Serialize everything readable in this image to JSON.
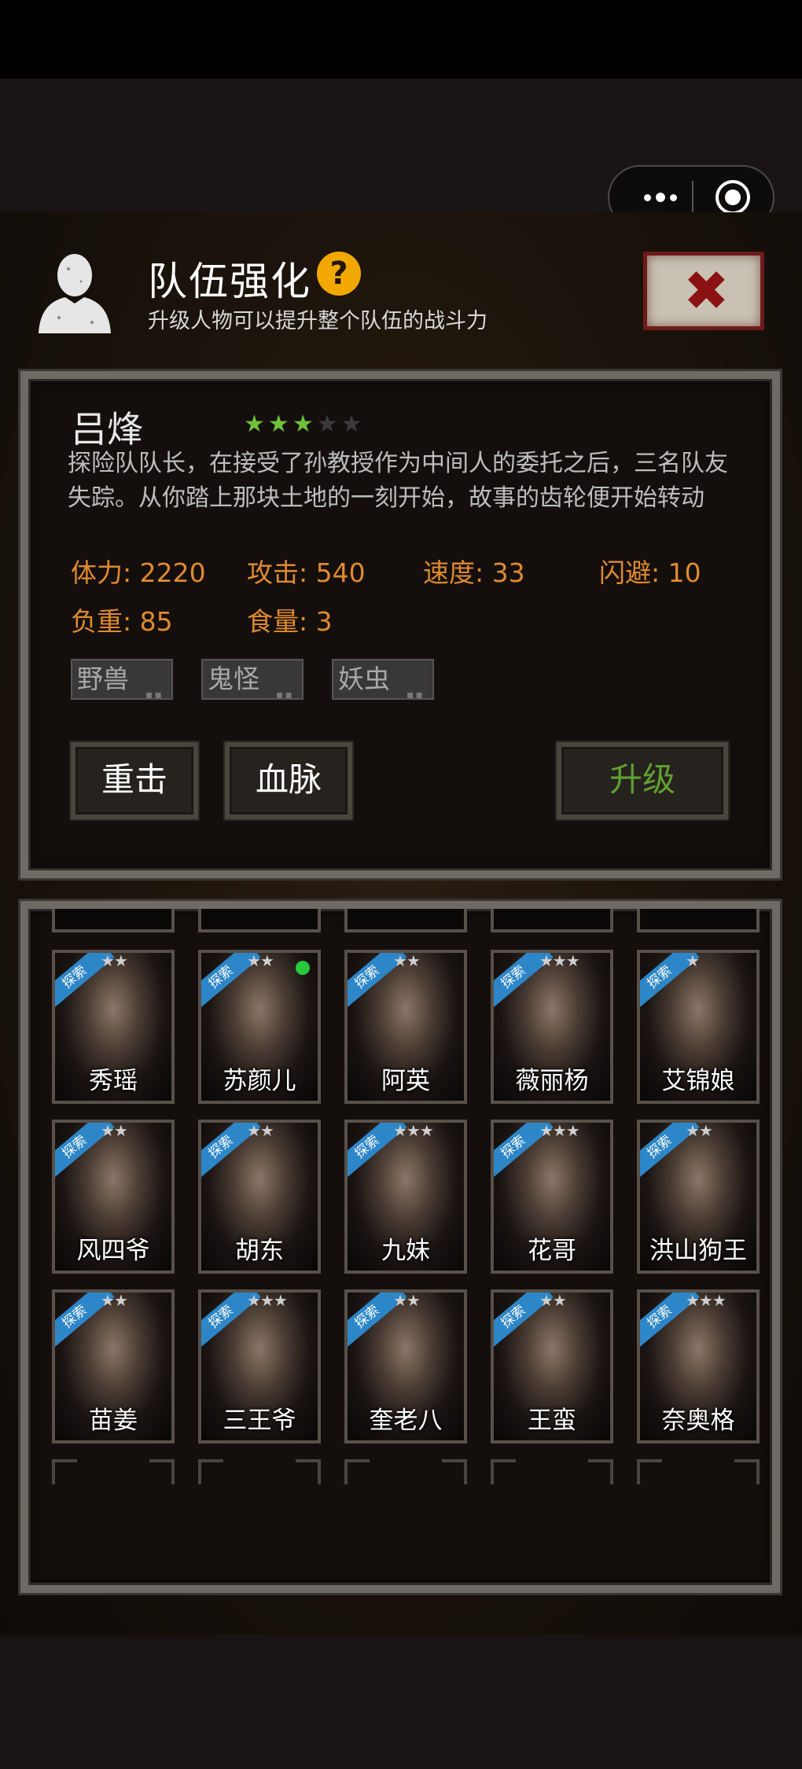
{
  "window": {
    "capsule_more": "more-dots",
    "capsule_close": "target"
  },
  "header": {
    "title": "队伍强化",
    "help": "?",
    "subtitle": "升级人物可以提升整个队伍的战斗力",
    "close": "✖"
  },
  "character": {
    "name": "吕烽",
    "stars_filled": 3,
    "stars_total": 5,
    "description": "探险队队长，在接受了孙教授作为中间人的委托之后，三名队友失踪。从你踏上那块土地的一刻开始，故事的齿轮便开始转动",
    "stats": [
      {
        "label": "体力: 2220"
      },
      {
        "label": "攻击: 540"
      },
      {
        "label": "速度: 33"
      },
      {
        "label": "闪避: 10"
      },
      {
        "label": "负重: 85"
      },
      {
        "label": "食量: 3"
      }
    ],
    "tags": [
      {
        "label": "野兽",
        "mini": "▪▪"
      },
      {
        "label": "鬼怪",
        "mini": "▪▪"
      },
      {
        "label": "妖虫",
        "mini": "▪▪"
      }
    ]
  },
  "buttons": {
    "skill1": "重击",
    "skill2": "血脉",
    "upgrade": "升级"
  },
  "ribbon_label": "探索",
  "roster": [
    {
      "name": "秀瑶",
      "stars": "★★",
      "online": false
    },
    {
      "name": "苏颜儿",
      "stars": "★★",
      "online": true
    },
    {
      "name": "阿英",
      "stars": "★★",
      "online": false
    },
    {
      "name": "薇丽杨",
      "stars": "★★★",
      "online": false
    },
    {
      "name": "艾锦娘",
      "stars": "★",
      "online": false
    },
    {
      "name": "风四爷",
      "stars": "★★",
      "online": false
    },
    {
      "name": "胡东",
      "stars": "★★",
      "online": false
    },
    {
      "name": "九妹",
      "stars": "★★★",
      "online": false
    },
    {
      "name": "花哥",
      "stars": "★★★",
      "online": false
    },
    {
      "name": "洪山狗王",
      "stars": "★★",
      "online": false
    },
    {
      "name": "苗姜",
      "stars": "★★",
      "online": false
    },
    {
      "name": "三王爷",
      "stars": "★★★",
      "online": false
    },
    {
      "name": "奎老八",
      "stars": "★★",
      "online": false
    },
    {
      "name": "王蛮",
      "stars": "★★",
      "online": false
    },
    {
      "name": "奈奥格",
      "stars": "★★★",
      "online": false
    }
  ]
}
